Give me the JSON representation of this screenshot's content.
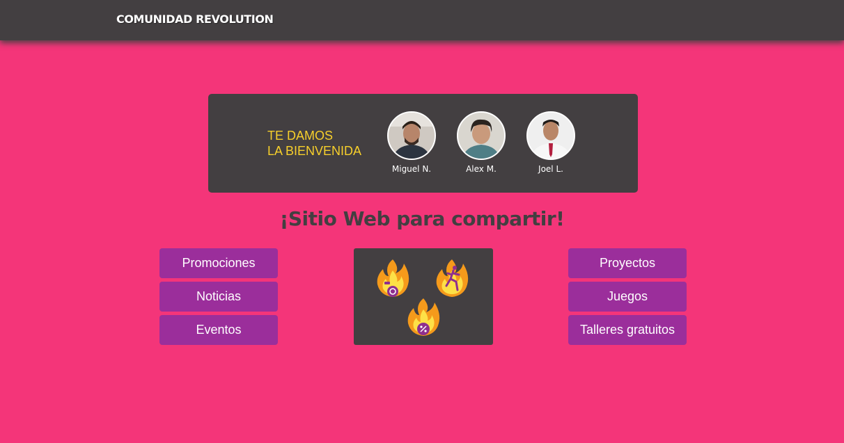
{
  "header": {
    "brand": "COMUNIDAD REVOLUTION"
  },
  "welcome": {
    "line1": "TE DAMOS",
    "line2": "LA BIENVENIDA",
    "members": [
      {
        "name": "Miguel N."
      },
      {
        "name": "Alex M."
      },
      {
        "name": "Joel L."
      }
    ]
  },
  "main": {
    "headline": "¡Sitio Web para compartir!",
    "left_buttons": [
      "Promociones",
      "Noticias",
      "Eventos"
    ],
    "right_buttons": [
      "Proyectos",
      "Juegos",
      "Talleres gratuitos"
    ],
    "emoji_icons": [
      "fire-clock-icon",
      "fire-runner-icon",
      "fire-percent-icon"
    ]
  },
  "colors": {
    "background": "#f43579",
    "dark": "#433f41",
    "accent_yellow": "#f7cf2b",
    "button_purple": "#9b2e9b"
  }
}
